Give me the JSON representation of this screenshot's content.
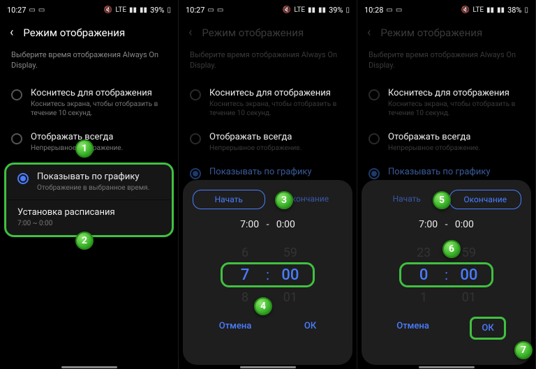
{
  "screens": [
    {
      "time": "10:27",
      "battery": "39%",
      "net": "LTE",
      "title": "Режим отображения",
      "subtitle": "Выберите время отображения Always On Display.",
      "options": [
        {
          "label": "Коснитесь для отображения",
          "sub": "Коснитесь экрана, чтобы отобразить в течение 10 секунд."
        },
        {
          "label": "Отображать всегда",
          "sub": "Непрерывное отображение."
        },
        {
          "label": "Показывать по графику",
          "sub": "Отображение в выбранное время."
        }
      ],
      "schedule": {
        "label": "Установка расписания",
        "range": "7:00 ~ 0:00"
      }
    },
    {
      "time": "10:27",
      "battery": "39%",
      "title": "Режим отображения",
      "subtitle": "Выберите время отображения Always On Display.",
      "tabs": {
        "start": "Начать",
        "end": "Окончание"
      },
      "range": {
        "from": "7:00",
        "sep": "-",
        "to": "0:00"
      },
      "picker": {
        "h_prev": "6",
        "h": "7",
        "h_next": "8",
        "m_prev": "59",
        "m": "00",
        "m_next": "01"
      },
      "actions": {
        "cancel": "Отмена",
        "ok": "ОК"
      }
    },
    {
      "time": "10:28",
      "battery": "38%",
      "title": "Режим отображения",
      "subtitle": "Выберите время отображения Always On Display.",
      "tabs": {
        "start": "Начать",
        "end": "Окончание"
      },
      "range": {
        "from": "7:00",
        "sep": "-",
        "to": "0:00"
      },
      "picker": {
        "h_prev": "23",
        "h": "0",
        "h_next": "1",
        "m_prev": "59",
        "m": "00",
        "m_next": "01"
      },
      "actions": {
        "cancel": "Отмена",
        "ok": "ОК"
      }
    }
  ],
  "badges": [
    "1",
    "2",
    "3",
    "4",
    "5",
    "6",
    "7"
  ],
  "status_icons": {
    "mute": "🔇",
    "sig": "▮▮▮▮"
  }
}
